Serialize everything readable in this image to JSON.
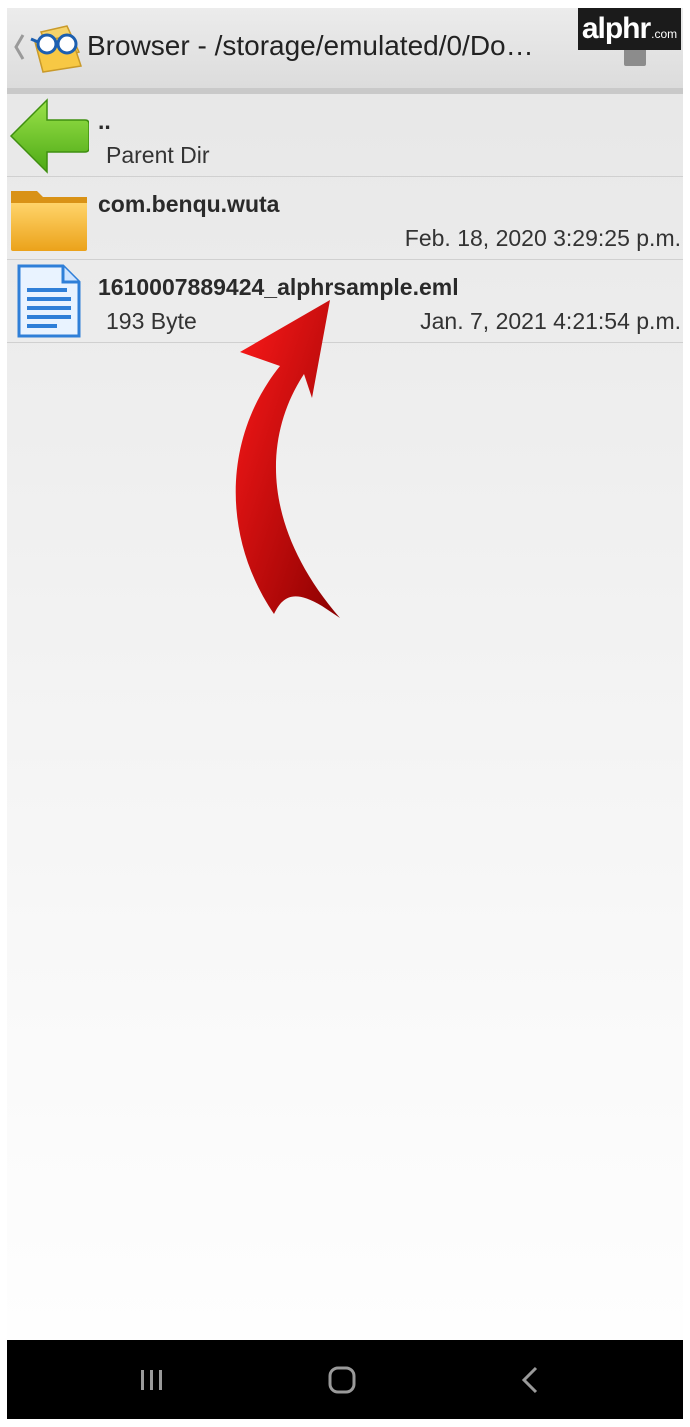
{
  "titlebar": {
    "title": "Browser - /storage/emulated/0/Do…",
    "app_icon": "glasses-folder-icon",
    "menu_icon": "overflow-menu-icon"
  },
  "watermark": {
    "main": "alphr",
    "sub": ".com"
  },
  "files": [
    {
      "name": "..",
      "sub": "Parent Dir",
      "date": "",
      "icon": "parent-dir-arrow-icon"
    },
    {
      "name": "com.benqu.wuta",
      "sub": "",
      "date": "Feb. 18, 2020 3:29:25 p.m.",
      "icon": "folder-icon"
    },
    {
      "name": "1610007889424_alphrsample.eml",
      "sub": "193 Byte",
      "date": "Jan. 7, 2021 4:21:54 p.m.",
      "icon": "document-icon"
    }
  ],
  "navbar": {
    "recents": "recents-icon",
    "home": "home-icon",
    "back": "back-icon"
  },
  "colors": {
    "arrow": "#c40000",
    "parent_arrow": "#6cc222",
    "folder": "#f2b234",
    "document": "#2f7fd8"
  }
}
